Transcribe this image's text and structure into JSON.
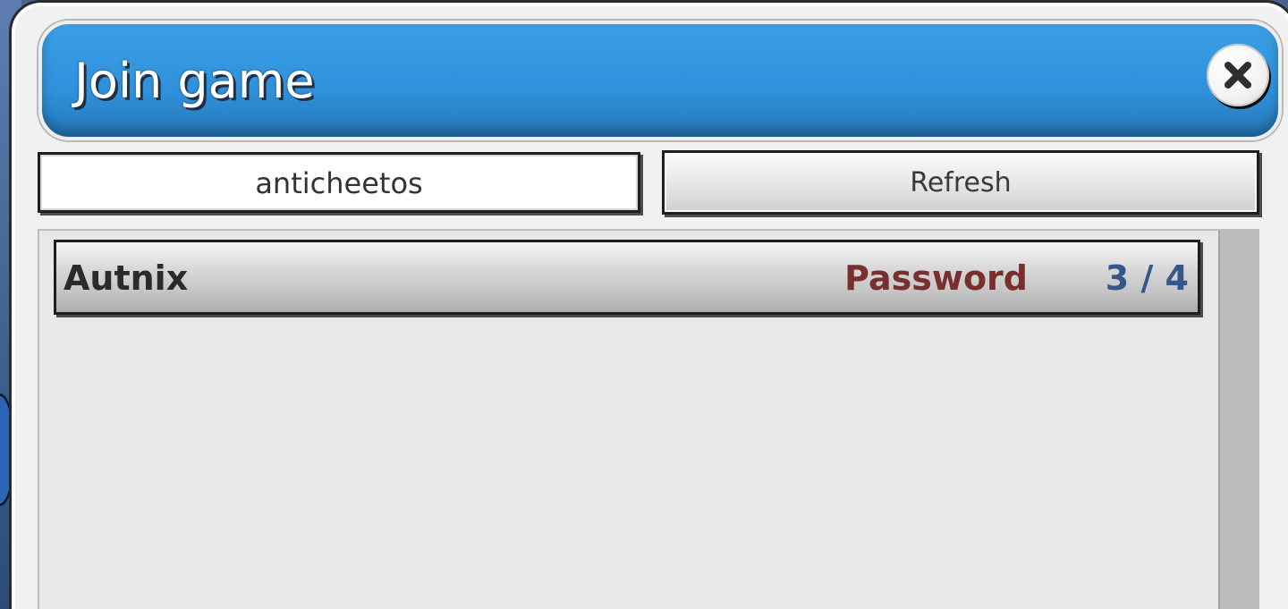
{
  "dialog": {
    "title": "Join game",
    "close_icon": "close-icon"
  },
  "controls": {
    "search_value": "anticheetos",
    "refresh_label": "Refresh"
  },
  "games": [
    {
      "name": "Autnix",
      "lock": "Password",
      "players": "3 / 4"
    }
  ],
  "colors": {
    "title_bar": "#3398df",
    "password_text": "#7a2f2f",
    "players_text": "#355789"
  }
}
